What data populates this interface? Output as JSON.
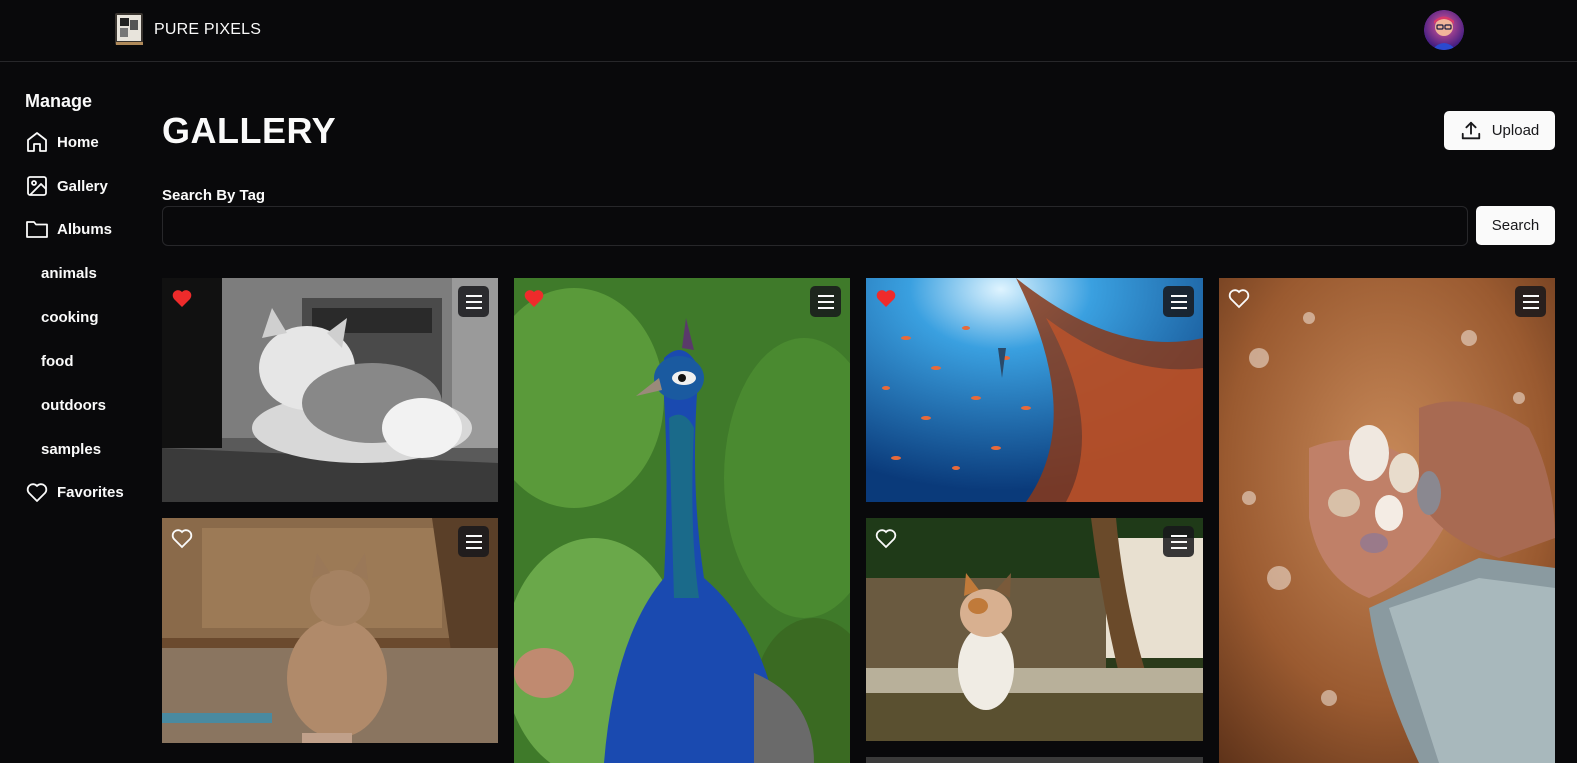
{
  "header": {
    "brand": "PURE PIXELS"
  },
  "sidebar": {
    "title": "Manage",
    "items": [
      {
        "label": "Home",
        "icon": "home-icon"
      },
      {
        "label": "Gallery",
        "icon": "image-icon"
      },
      {
        "label": "Albums",
        "icon": "folder-icon"
      }
    ],
    "albums": [
      "animals",
      "cooking",
      "food",
      "outdoors",
      "samples"
    ],
    "favorites": {
      "label": "Favorites",
      "icon": "heart-outline-icon"
    }
  },
  "main": {
    "title": "GALLERY",
    "upload_label": "Upload",
    "search_label": "Search By Tag",
    "search_value": "",
    "search_button": "Search"
  },
  "gallery": [
    {
      "subject": "gray cat on car hood",
      "favorite": true
    },
    {
      "subject": "peacock",
      "favorite": true
    },
    {
      "subject": "school of fish underwater",
      "favorite": true
    },
    {
      "subject": "hands holding seashells",
      "favorite": false
    },
    {
      "subject": "fluffy cat sitting",
      "favorite": false
    },
    {
      "subject": "calico cat by tree",
      "favorite": false
    }
  ],
  "colors": {
    "background": "#09090b",
    "accent_red": "#ef2b2b",
    "button_bg": "#fafafa"
  }
}
